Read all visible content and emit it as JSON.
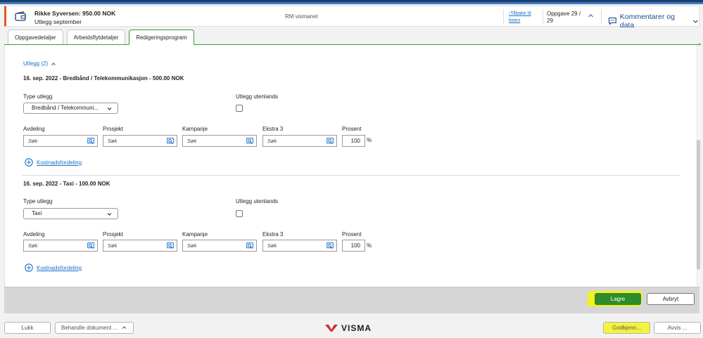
{
  "header": {
    "title": "Rikke Syversen: 950.00 NOK",
    "subtitle": "Utlegg september",
    "center": "RM vismanet",
    "back_link": "Tilbake til listen",
    "task_counter": "Oppgave 29 / 29",
    "comments_label": "Kommentarer og data",
    "accent_color": "#e35b1e"
  },
  "tabs": [
    {
      "label": "Oppgavedetaljer"
    },
    {
      "label": "Arbeidsflytdetaljer"
    },
    {
      "label": "Redigeringsprogram",
      "active": true
    }
  ],
  "utlegg": {
    "toggle_label": "Utlegg (2)",
    "items": [
      {
        "title": "16. sep. 2022 - Bredbånd / Telekommunikasjon - 500.00 NOK",
        "type_label": "Type utlegg",
        "type_value": "Bredbånd / Telekommuni...",
        "abroad_label": "Utlegg utenlands",
        "abroad_checked": false,
        "fields": [
          {
            "label": "Avdeling",
            "placeholder": "Søk"
          },
          {
            "label": "Prosjekt",
            "placeholder": "Søk"
          },
          {
            "label": "Kampanje",
            "placeholder": "Søk"
          },
          {
            "label": "Ekstra 3",
            "placeholder": "Søk"
          }
        ],
        "percent_label": "Prosent",
        "percent_value": "100",
        "percent_sign": "%",
        "cost_link": "Kostnadsfordeling"
      },
      {
        "title": "16. sep. 2022 - Taxi - 100.00 NOK",
        "type_label": "Type utlegg",
        "type_value": "Taxi",
        "abroad_label": "Utlegg utenlands",
        "abroad_checked": false,
        "fields": [
          {
            "label": "Avdeling",
            "placeholder": "Søk"
          },
          {
            "label": "Prosjekt",
            "placeholder": "Søk"
          },
          {
            "label": "Kampanje",
            "placeholder": "Søk"
          },
          {
            "label": "Ekstra 3",
            "placeholder": "Søk"
          }
        ],
        "percent_label": "Prosent",
        "percent_value": "100",
        "percent_sign": "%",
        "cost_link": "Kostnadsfordeling"
      }
    ]
  },
  "actions": {
    "save_label": "Lagre",
    "cancel_label": "Avbryt",
    "save_color": "#2f8c28"
  },
  "footer": {
    "close_label": "Lukk",
    "handle_label": "Behandle dokument ...",
    "brand": "VISMA",
    "approve_label": "Godkjenn...",
    "reject_label": "Avvis ..."
  }
}
